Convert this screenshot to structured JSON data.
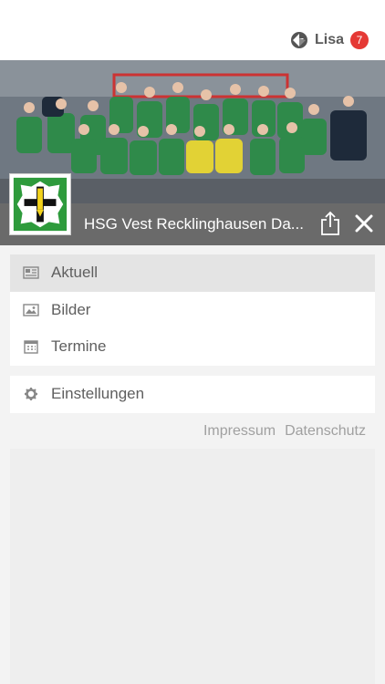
{
  "header": {
    "user_name": "Lisa",
    "notification_count": "7",
    "logo_icon": "app-logo-icon"
  },
  "club": {
    "name": "HSG Vest Recklinghausen Da...",
    "share_icon": "share-icon",
    "close_icon": "close-icon"
  },
  "menu": {
    "items": [
      {
        "label": "Aktuell",
        "icon": "newspaper-icon",
        "active": true
      },
      {
        "label": "Bilder",
        "icon": "image-icon",
        "active": false
      },
      {
        "label": "Termine",
        "icon": "calendar-icon",
        "active": false
      }
    ],
    "settings": {
      "label": "Einstellungen",
      "icon": "gear-icon"
    }
  },
  "footer_links": {
    "impressum": "Impressum",
    "datenschutz": "Datenschutz"
  },
  "colors": {
    "badge": "#e53935",
    "hero_bar": "#5f5f5f",
    "crest_green": "#2e9b3c",
    "crest_yellow": "#f2d21b"
  }
}
